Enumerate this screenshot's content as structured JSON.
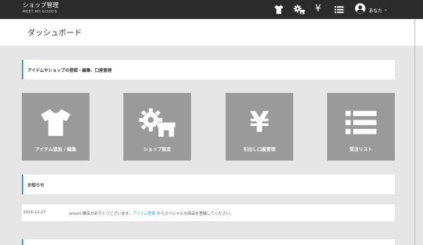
{
  "header": {
    "brand_title": "ショップ管理",
    "brand_sub": "MEET-MY-GOODS",
    "yen_symbol": "¥",
    "user_label": "あなた",
    "caret": "⌄",
    "icons": [
      "tshirt-icon",
      "gear-shop-icon",
      "yen-icon",
      "list-icon",
      "user-avatar-icon"
    ]
  },
  "page": {
    "title": "ダッシュボード"
  },
  "sections": {
    "register": "アイテムやショップの登録・編集、口座管理",
    "news": "お知らせ"
  },
  "tiles": [
    {
      "label": "アイテム追加 / 編集",
      "icon": "tshirt-icon"
    },
    {
      "label": "ショップ設定",
      "icon": "gear-shop-icon"
    },
    {
      "label": "引出し口座管理",
      "icon": "yen-icon"
    },
    {
      "label": "受注リスト",
      "icon": "list-icon"
    }
  ],
  "tile_yen_symbol": "¥",
  "news": [
    {
      "date": "2016-12-27",
      "text_before": "ishishi 開店おめでとうございます。",
      "link_text": "アイテム登録",
      "text_after": " からスペシャルな商品を登録してください。"
    }
  ],
  "colors": {
    "header_bg": "#2b2b2b",
    "page_bg": "#e6e6e6",
    "tile_bg": "#9a9a9a",
    "accent": "#3aa3d9"
  }
}
